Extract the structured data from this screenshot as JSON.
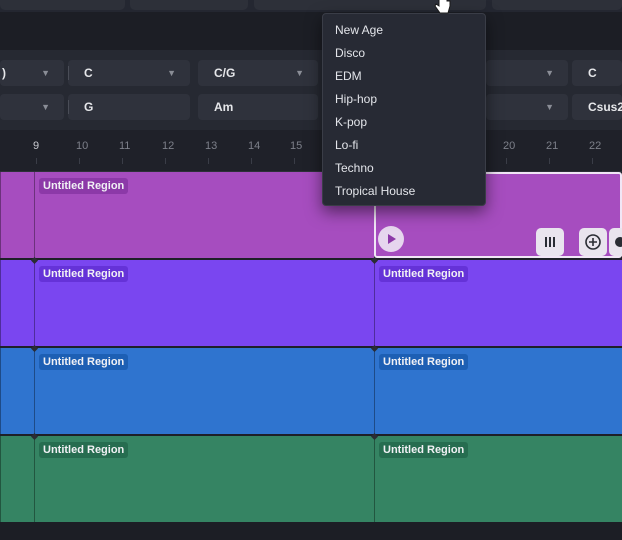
{
  "dropdown": {
    "items": [
      "New Age",
      "Disco",
      "EDM",
      "Hip-hop",
      "K-pop",
      "Lo-fi",
      "Techno",
      "Tropical House"
    ]
  },
  "chords": {
    "row1": [
      "",
      "C",
      "C/G",
      "C"
    ],
    "row2": [
      "G",
      "Am",
      "Csus2"
    ]
  },
  "ruler": {
    "ticks": [
      "9",
      "10",
      "11",
      "12",
      "13",
      "14",
      "15",
      "20",
      "21",
      "22"
    ]
  },
  "tracks": [
    {
      "color": "#a64dbf",
      "label_bg": "#8c39a8",
      "regions": [
        "Untitled Region",
        ""
      ]
    },
    {
      "color": "#7a46f0",
      "label_bg": "#6532d8",
      "regions": [
        "Untitled Region",
        "Untitled Region"
      ]
    },
    {
      "color": "#2f74cf",
      "label_bg": "#1d5fb4",
      "regions": [
        "Untitled Region",
        "Untitled Region"
      ]
    },
    {
      "color": "#358463",
      "label_bg": "#266d50",
      "regions": [
        "Untitled Region",
        "Untitled Region"
      ]
    }
  ],
  "icons": {
    "play": "play-icon",
    "bars": "bars-icon",
    "add": "add-sparkle-icon",
    "cursor": "hand-cursor-icon"
  }
}
